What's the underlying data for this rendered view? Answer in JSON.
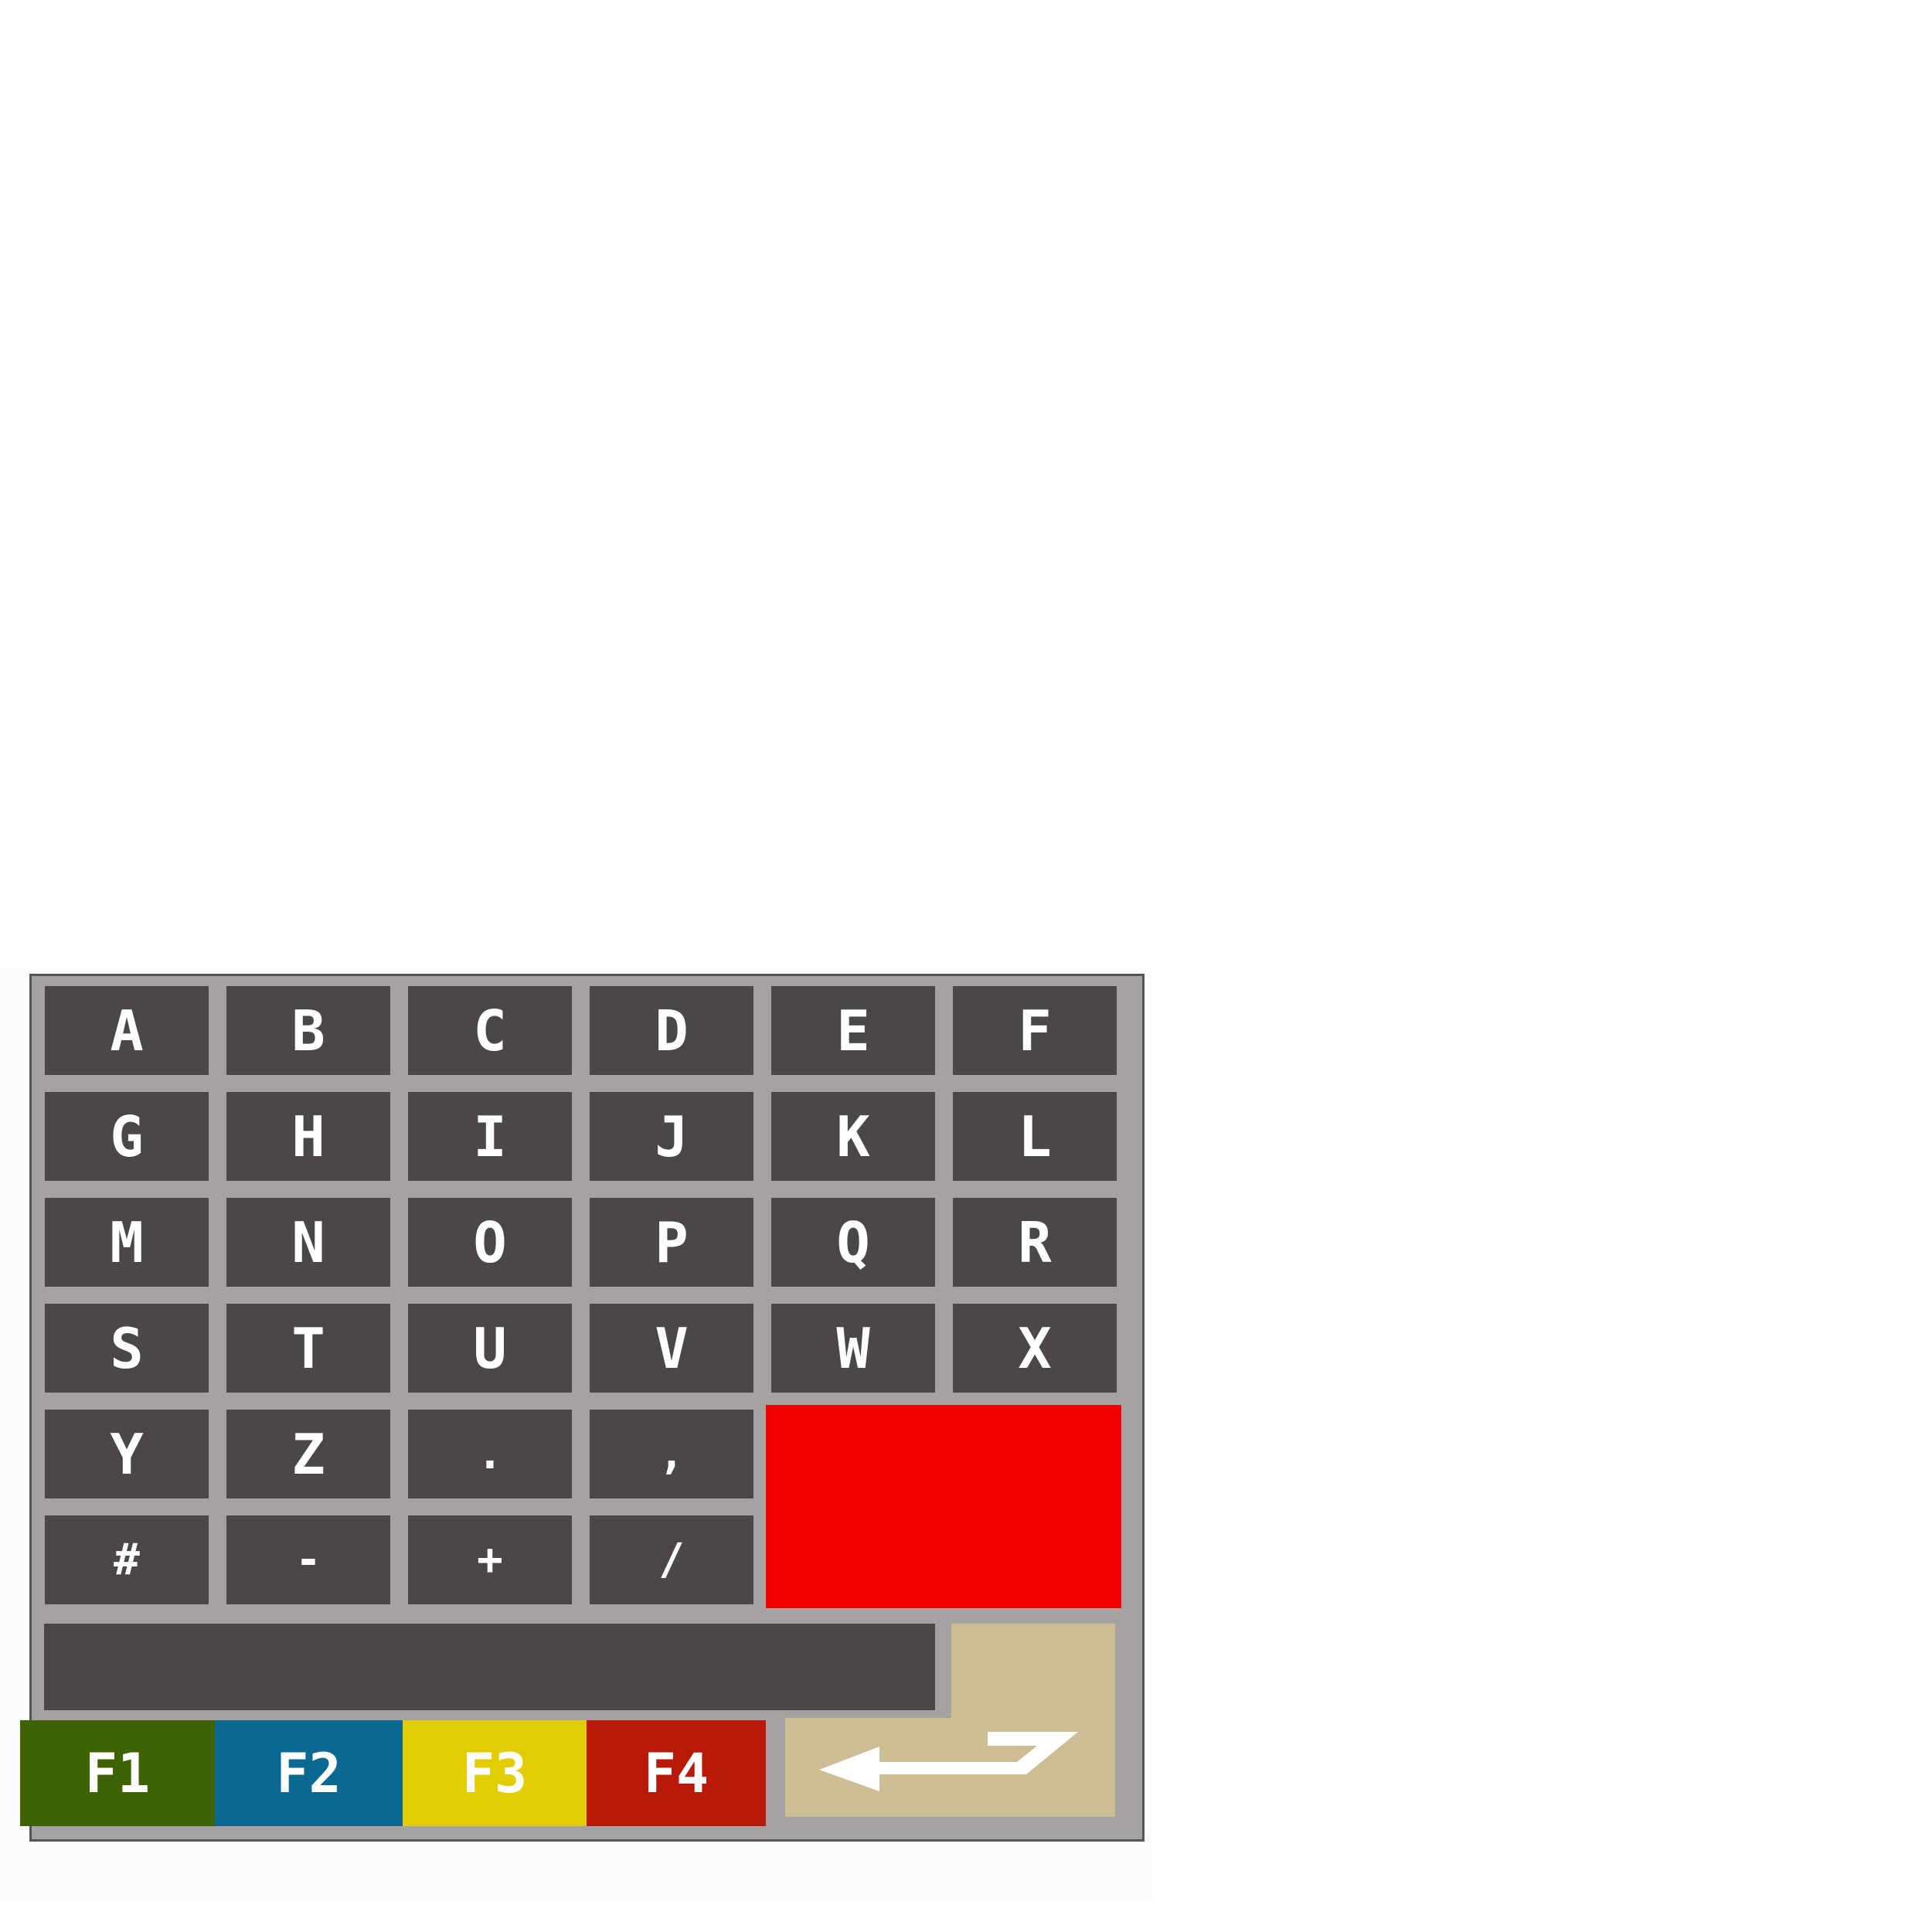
{
  "keyboard": {
    "rows": [
      [
        "A",
        "B",
        "C",
        "D",
        "E",
        "F"
      ],
      [
        "G",
        "H",
        "I",
        "J",
        "K",
        "L"
      ],
      [
        "M",
        "N",
        "O",
        "P",
        "Q",
        "R"
      ],
      [
        "S",
        "T",
        "U",
        "V",
        "W",
        "X"
      ],
      [
        "Y",
        "Z",
        ".",
        ","
      ],
      [
        "#",
        "-",
        "+",
        "/"
      ]
    ],
    "function_keys": [
      "F1",
      "F2",
      "F3",
      "F4"
    ],
    "colors": {
      "panel": "#a7a2a2",
      "key": "#4b4647",
      "key_text": "#ffffff",
      "cancel": "#f20000",
      "enter": "#cdbd94",
      "f1": "#3e6304",
      "f2": "#0b6890",
      "f3": "#e2cc02",
      "f4": "#b71a08"
    },
    "icons": {
      "enter": "enter-return-arrow-icon"
    }
  }
}
